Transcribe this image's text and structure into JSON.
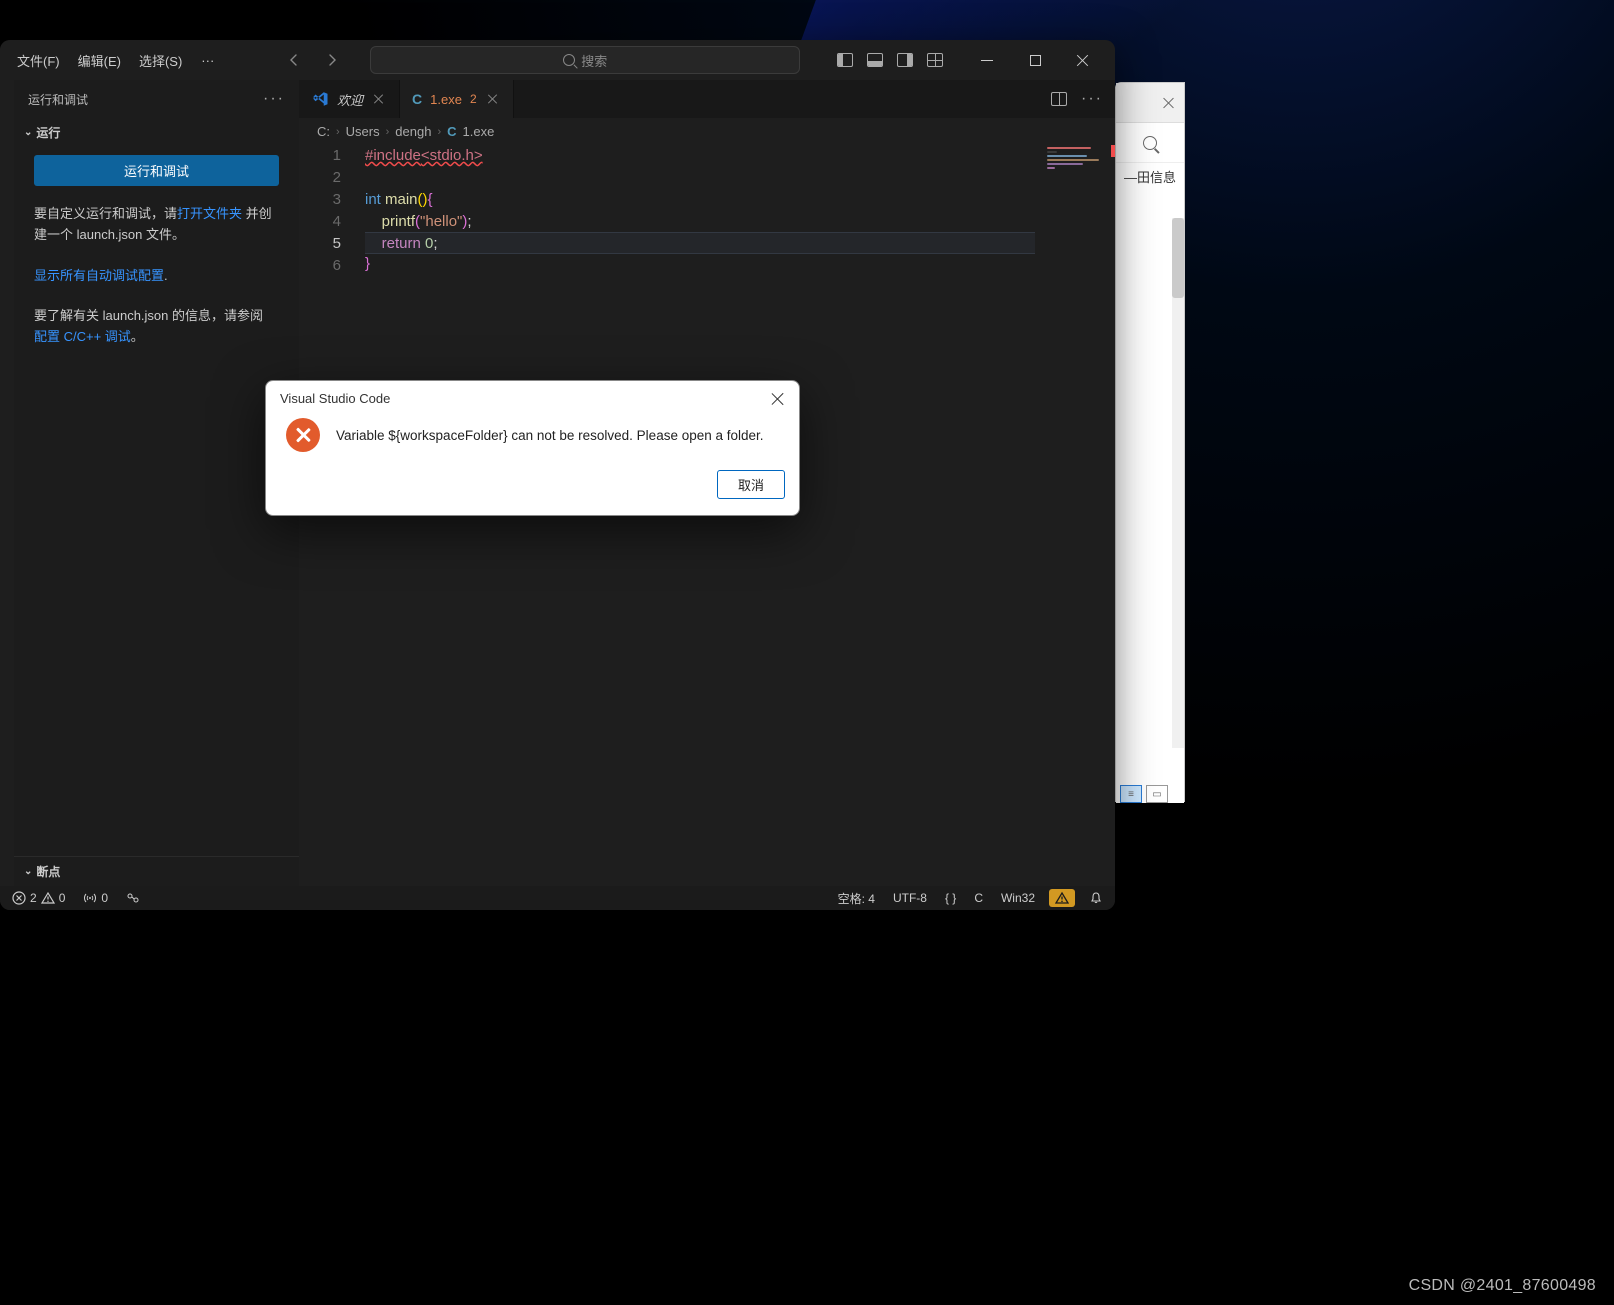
{
  "menubar": {
    "file": "文件(F)",
    "edit": "编辑(E)",
    "select": "选择(S)",
    "more": "···"
  },
  "searchbox": {
    "placeholder": "搜索"
  },
  "sidebar": {
    "title": "运行和调试",
    "section_run": "运行",
    "run_button": "运行和调试",
    "para1_a": "要自定义运行和调试，请",
    "para1_link": "打开文件夹",
    "para1_b": " 并创建一个 launch.json 文件。",
    "para2_link": "显示所有自动调试配置",
    "para2_dot": ".",
    "para3_a": "要了解有关 launch.json 的信息，请参阅 ",
    "para3_link": "配置 C/C++ 调试",
    "para3_b": "。",
    "section_breakpoints": "断点"
  },
  "tabs": {
    "welcome": {
      "label": "欢迎"
    },
    "file": {
      "label": "1.exe",
      "badge": "2"
    }
  },
  "breadcrumb": {
    "c": "C:",
    "users": "Users",
    "dengh": "dengh",
    "file": "1.exe"
  },
  "code": {
    "lines": [
      "1",
      "2",
      "3",
      "4",
      "5",
      "6"
    ],
    "l1_include": "#include",
    "l1_stdio": "<stdio.h>",
    "l3_int": "int",
    "l3_main": " main",
    "l4_printf": "printf",
    "l4_str": "\"hello\"",
    "l5_return": "return",
    "l5_zero": " 0"
  },
  "dialog": {
    "title": "Visual Studio Code",
    "message": "Variable ${workspaceFolder} can not be resolved. Please open a folder.",
    "cancel": "取消"
  },
  "statusbar": {
    "errors": "2",
    "warnings": "0",
    "ports": "0",
    "spaces": "空格: 4",
    "encoding": "UTF-8",
    "braces": "{ }",
    "lang": "C",
    "platform": "Win32"
  },
  "right_window": {
    "text": "—田信息"
  },
  "watermark": "CSDN @2401_87600498",
  "colors": {
    "accent": "#0e639c",
    "link": "#3794ff",
    "orange_tab": "#e28651",
    "error_icon": "#e25b2c",
    "warn_bg": "#d29922"
  }
}
